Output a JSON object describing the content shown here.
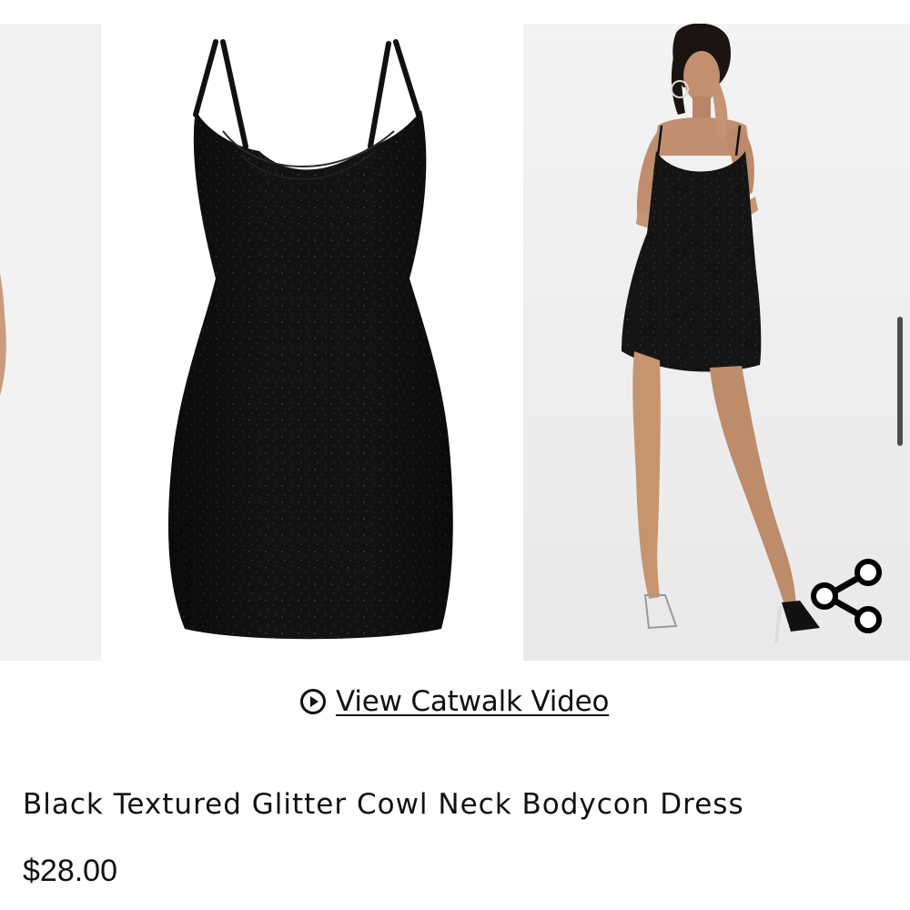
{
  "video_link": {
    "label": "View Catwalk Video",
    "icon": "play-circle-icon"
  },
  "product": {
    "title": "Black Textured Glitter Cowl Neck Bodycon Dress",
    "price": "$28.00"
  },
  "gallery": {
    "images": [
      {
        "name": "model-side-view-photo"
      },
      {
        "name": "dress-product-photo"
      },
      {
        "name": "model-front-view-photo"
      }
    ],
    "share_icon": "share-icon"
  },
  "colors": {
    "dress": "#121212",
    "skin": "#c79a7b",
    "background": "#ffffff",
    "photo_bg": "#efefef",
    "text": "#111111"
  }
}
